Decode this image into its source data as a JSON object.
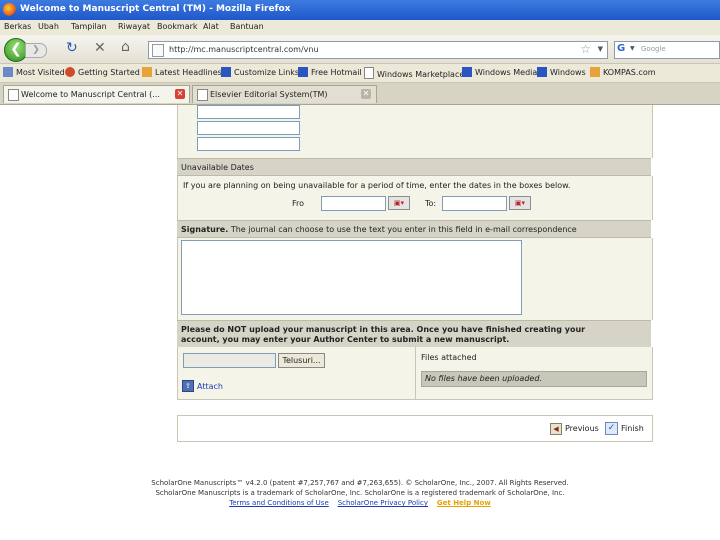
{
  "window": {
    "title": "Welcome to Manuscript Central (TM) - Mozilla Firefox"
  },
  "menu": [
    "Berkas",
    "Ubah",
    "Tampilan",
    "Riwayat",
    "Bookmark",
    "Alat",
    "Bantuan"
  ],
  "nav": {
    "url": "http://mc.manuscriptcentral.com/vnu",
    "search_placeholder": "Google",
    "search_engine": "G"
  },
  "bookmarks": [
    "Most Visited",
    "Getting Started",
    "Latest Headlines",
    "Customize Links",
    "Free Hotmail",
    "Windows Marketplace",
    "Windows Media",
    "Windows",
    "KOMPAS.com"
  ],
  "tabs": [
    {
      "label": "Welcome to Manuscript Central (...",
      "active": true
    },
    {
      "label": "Elsevier Editorial System(TM)",
      "active": false
    }
  ],
  "unavailable": {
    "heading": "Unavailable Dates",
    "instructions": "If you are planning on being unavailable for a period of time, enter the dates in the boxes below.",
    "from_label": "Fro",
    "to_label": "To:"
  },
  "signature": {
    "label": "Signature.",
    "description": "The journal can choose to use the text you enter in this field in e-mail correspondence"
  },
  "upload": {
    "warning_line1": "Please do NOT upload your manuscript in this area. Once you have finished creating your",
    "warning_line2": "account, you may enter your Author Center to submit a new manuscript.",
    "browse_label": "Telusuri...",
    "attach_label": "Attach",
    "files_heading": "Files attached",
    "no_files": "No files have been uploaded."
  },
  "actions": {
    "previous": "Previous",
    "finish": "Finish"
  },
  "footer": {
    "line1": "ScholarOne Manuscripts™ v4.2.0 (patent #7,257,767 and #7,263,655). © ScholarOne, Inc., 2007. All Rights Reserved.",
    "line2": "ScholarOne Manuscripts is a trademark of ScholarOne, Inc. ScholarOne is a registered trademark of ScholarOne, Inc.",
    "terms": "Terms and Conditions of Use",
    "privacy": "ScholarOne Privacy Policy",
    "help": "Get Help Now"
  },
  "colors": {
    "panel": "#f5f4e8",
    "section_header": "#d6d4c6",
    "titlebar": "#2a64d6",
    "link": "#1a3db3",
    "help": "#e6a100"
  }
}
